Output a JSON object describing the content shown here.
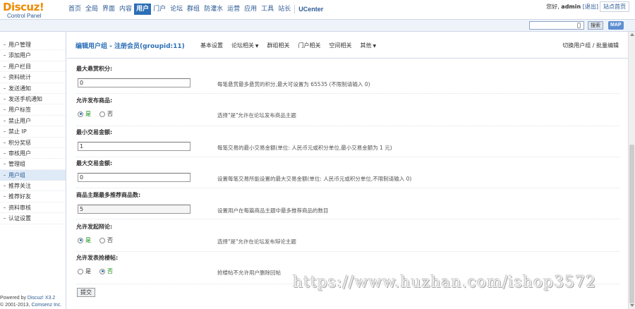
{
  "logo": {
    "main": "Discuz!",
    "sub": "Control Panel"
  },
  "topnav": {
    "items": [
      {
        "label": "首页",
        "active": false
      },
      {
        "label": "全局",
        "active": false
      },
      {
        "label": "界面",
        "active": false
      },
      {
        "label": "内容",
        "active": false
      },
      {
        "label": "用户",
        "active": true
      },
      {
        "label": "门户",
        "active": false
      },
      {
        "label": "论坛",
        "active": false
      },
      {
        "label": "群组",
        "active": false
      },
      {
        "label": "防灌水",
        "active": false
      },
      {
        "label": "运营",
        "active": false
      },
      {
        "label": "应用",
        "active": false
      },
      {
        "label": "工具",
        "active": false
      },
      {
        "label": "站长",
        "active": false
      }
    ],
    "ucenter": "UCenter"
  },
  "user": {
    "greeting": "您好,",
    "name": "admin",
    "logout": "[退出]"
  },
  "site_home": "站点首页",
  "search": {
    "placeholder": "",
    "button": "搜索",
    "map": "MAP"
  },
  "sidebar": {
    "items": [
      {
        "label": "用户管理",
        "active": false
      },
      {
        "label": "添加用户",
        "active": false
      },
      {
        "label": "用户栏目",
        "active": false
      },
      {
        "label": "资料统计",
        "active": false
      },
      {
        "label": "发送通知",
        "active": false
      },
      {
        "label": "发送手机通知",
        "active": false
      },
      {
        "label": "用户标签",
        "active": false
      },
      {
        "label": "禁止用户",
        "active": false
      },
      {
        "label": "禁止 IP",
        "active": false
      },
      {
        "label": "积分奖惩",
        "active": false
      },
      {
        "label": "审核用户",
        "active": false
      },
      {
        "label": "管理组",
        "active": false
      },
      {
        "label": "用户组",
        "active": true
      },
      {
        "label": "推荐关注",
        "active": false
      },
      {
        "label": "推荐好友",
        "active": false
      },
      {
        "label": "资料审核",
        "active": false
      },
      {
        "label": "认证设置",
        "active": false
      }
    ],
    "powered_prefix": "Powered by ",
    "powered_brand": "Discuz! X3.2",
    "copyright_prefix": "© 2001-2013, ",
    "copyright_brand": "Comsenz Inc."
  },
  "page": {
    "title": "编辑用户组 - 注册会员(groupid:11)",
    "tabs": [
      {
        "label": "基本设置",
        "dropdown": false
      },
      {
        "label": "论坛相关",
        "dropdown": true
      },
      {
        "label": "群组相关",
        "dropdown": false
      },
      {
        "label": "门户相关",
        "dropdown": false
      },
      {
        "label": "空间相关",
        "dropdown": false
      },
      {
        "label": "其他",
        "dropdown": true
      }
    ],
    "switch_link": "切换用户组 / 批量编辑"
  },
  "form": {
    "max_reward": {
      "label": "最大悬赏积分:",
      "value": "0",
      "help": "每笔悬赏最多悬赏的积分,最大可设置为 65535 (不限制请输入 0)"
    },
    "allow_trade": {
      "label": "允许发布商品:",
      "yes": "是",
      "no": "否",
      "selected": "yes",
      "help": "选择\"是\"允许在论坛发布商品主题"
    },
    "min_trade": {
      "label": "最小交易金额:",
      "value": "1",
      "help": "每笔交易的最小交易金额(单位: 人民币元或积分单位,最小交易金额为 1 元)"
    },
    "max_trade": {
      "label": "最大交易金额:",
      "value": "0",
      "help": "设置每笔交易所能设置的最大交易金额(单位: 人民币元或积分单位,不限制请输入 0)"
    },
    "max_recommend": {
      "label": "商品主题最多推荐商品数:",
      "value": "5",
      "help": "设置用户在每篇商品主题中最多推荐商品的数目"
    },
    "allow_debate": {
      "label": "允许发起辩论:",
      "yes": "是",
      "no": "否",
      "selected": "yes",
      "help": "选择\"是\"允许在论坛发布辩论主题"
    },
    "allow_rush": {
      "label": "允许发表抢楼帖:",
      "yes": "是",
      "no": "否",
      "selected": "no",
      "help": "抢楼帖不允许用户删除回帖"
    },
    "submit": "提交"
  },
  "watermark": "https://www.huzhan.com/ishop3572"
}
